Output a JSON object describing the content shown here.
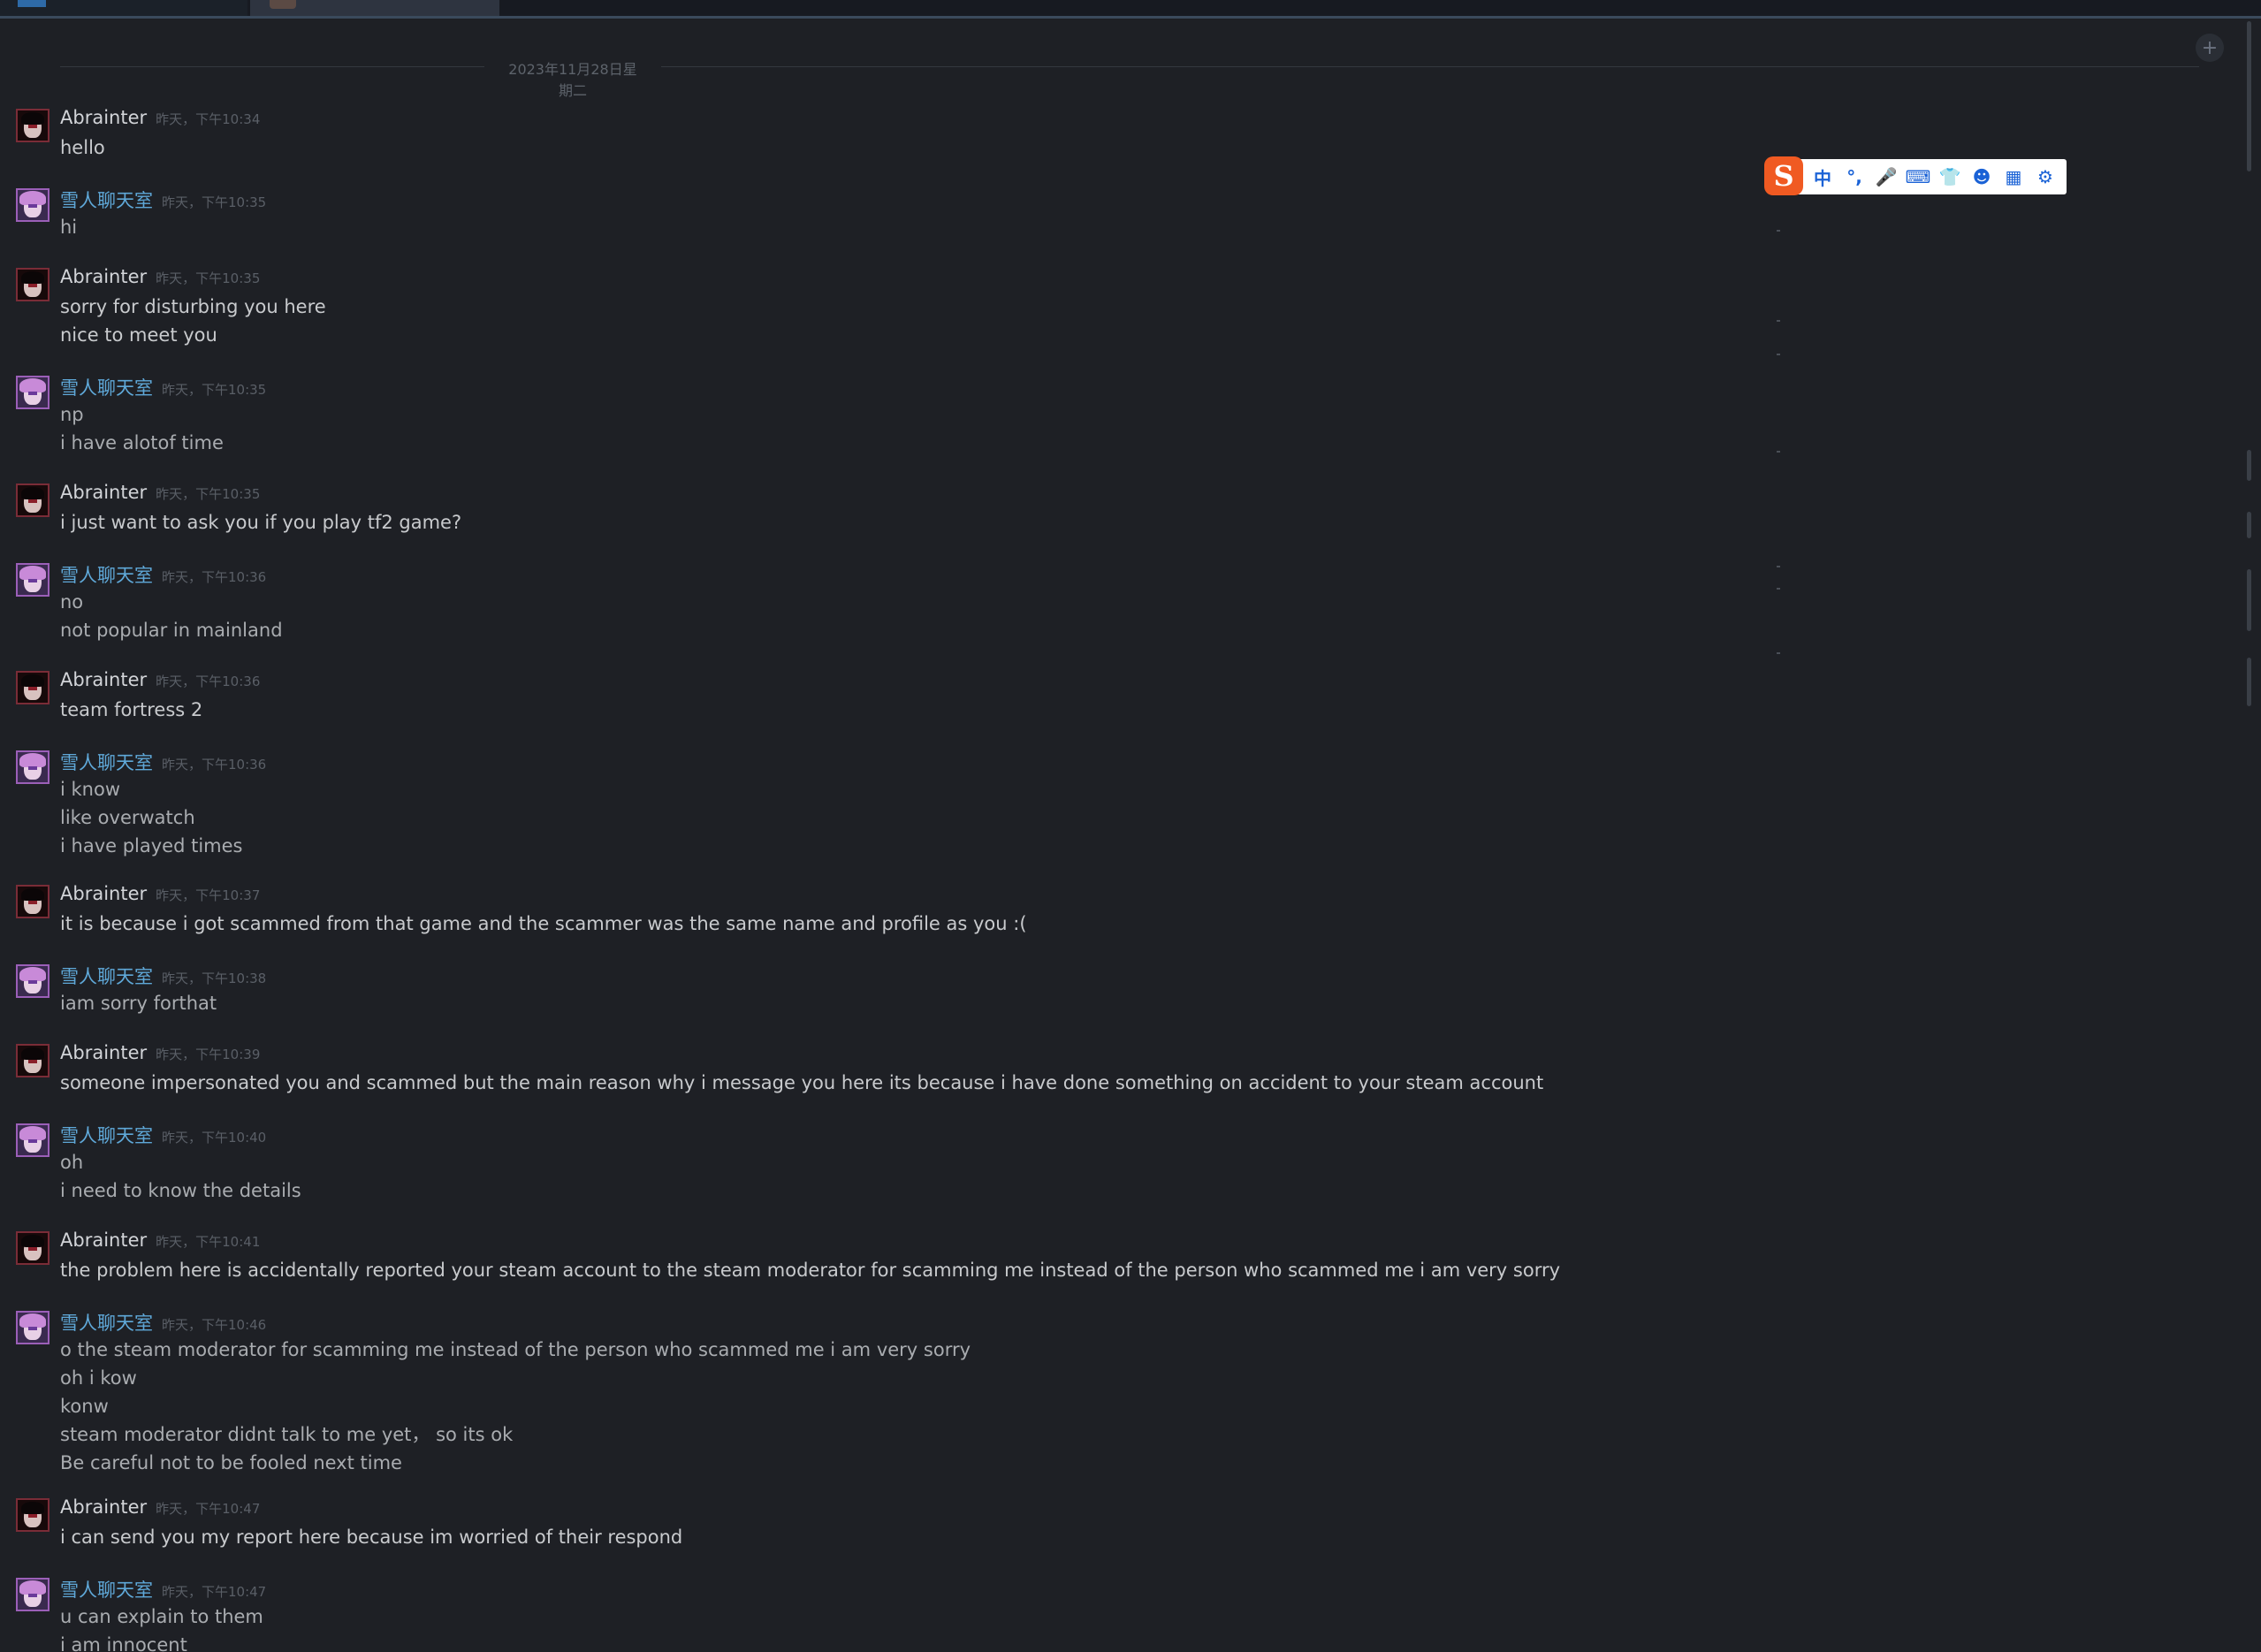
{
  "date_divider": "2023年11月28日星期二",
  "ime_toolbar": {
    "logo": "S",
    "buttons": [
      {
        "name": "chinese-mode",
        "glyph": "中"
      },
      {
        "name": "punctuation",
        "glyph": "°,"
      },
      {
        "name": "microphone-icon",
        "glyph": "🎤"
      },
      {
        "name": "keyboard-icon",
        "glyph": "⌨"
      },
      {
        "name": "skin-icon",
        "glyph": "👕"
      },
      {
        "name": "robot-icon",
        "glyph": "☻"
      },
      {
        "name": "apps-icon",
        "glyph": "▦"
      },
      {
        "name": "settings-icon",
        "glyph": "⚙"
      }
    ]
  },
  "messages": [
    {
      "sender": "Abrainter",
      "type": "a",
      "time": "昨天，下午10:34",
      "lines": [
        "hello"
      ]
    },
    {
      "sender": "雪人聊天室",
      "type": "b",
      "time": "昨天，下午10:35",
      "lines": [
        "hi"
      ]
    },
    {
      "sender": "Abrainter",
      "type": "a",
      "time": "昨天，下午10:35",
      "lines": [
        "sorry for disturbing you here",
        "nice to meet you"
      ]
    },
    {
      "sender": "雪人聊天室",
      "type": "b",
      "time": "昨天，下午10:35",
      "lines": [
        "np",
        "i have alotof time"
      ]
    },
    {
      "sender": "Abrainter",
      "type": "a",
      "time": "昨天，下午10:35",
      "lines": [
        "i just want to ask you if you play tf2 game?"
      ]
    },
    {
      "sender": "雪人聊天室",
      "type": "b",
      "time": "昨天，下午10:36",
      "lines": [
        "no",
        "not popular in mainland"
      ]
    },
    {
      "sender": "Abrainter",
      "type": "a",
      "time": "昨天，下午10:36",
      "lines": [
        "team fortress 2"
      ]
    },
    {
      "sender": "雪人聊天室",
      "type": "b",
      "time": "昨天，下午10:36",
      "lines": [
        "i know",
        "like overwatch",
        "i have played times"
      ]
    },
    {
      "sender": "Abrainter",
      "type": "a",
      "time": "昨天，下午10:37",
      "lines": [
        "it is because i got scammed from that game and the scammer was the same name and profile as you :("
      ]
    },
    {
      "sender": "雪人聊天室",
      "type": "b",
      "time": "昨天，下午10:38",
      "lines": [
        "iam sorry forthat"
      ]
    },
    {
      "sender": "Abrainter",
      "type": "a",
      "time": "昨天，下午10:39",
      "lines": [
        "someone impersonated you and scammed but the main reason why i message you here its because i have done something on accident to your steam account"
      ]
    },
    {
      "sender": "雪人聊天室",
      "type": "b",
      "time": "昨天，下午10:40",
      "lines": [
        "oh",
        "i need to know the details"
      ]
    },
    {
      "sender": "Abrainter",
      "type": "a",
      "time": "昨天，下午10:41",
      "lines": [
        "the problem here is accidentally reported your steam account to the steam moderator for scamming me instead of the person who scammed me i am very sorry"
      ]
    },
    {
      "sender": "雪人聊天室",
      "type": "b",
      "time": "昨天，下午10:46",
      "lines": [
        "o the steam moderator for scamming me instead of the person who scammed me i am very sorry",
        "oh i kow",
        "konw",
        "steam moderator didnt talk to me yet， so its ok",
        "Be careful not to be fooled next time"
      ]
    },
    {
      "sender": "Abrainter",
      "type": "a",
      "time": "昨天，下午10:47",
      "lines": [
        "i can send you my report here because im worried of their respond"
      ]
    },
    {
      "sender": "雪人聊天室",
      "type": "b",
      "time": "昨天，下午10:47",
      "lines": [
        "u can explain to them",
        "i am innocent"
      ]
    }
  ]
}
